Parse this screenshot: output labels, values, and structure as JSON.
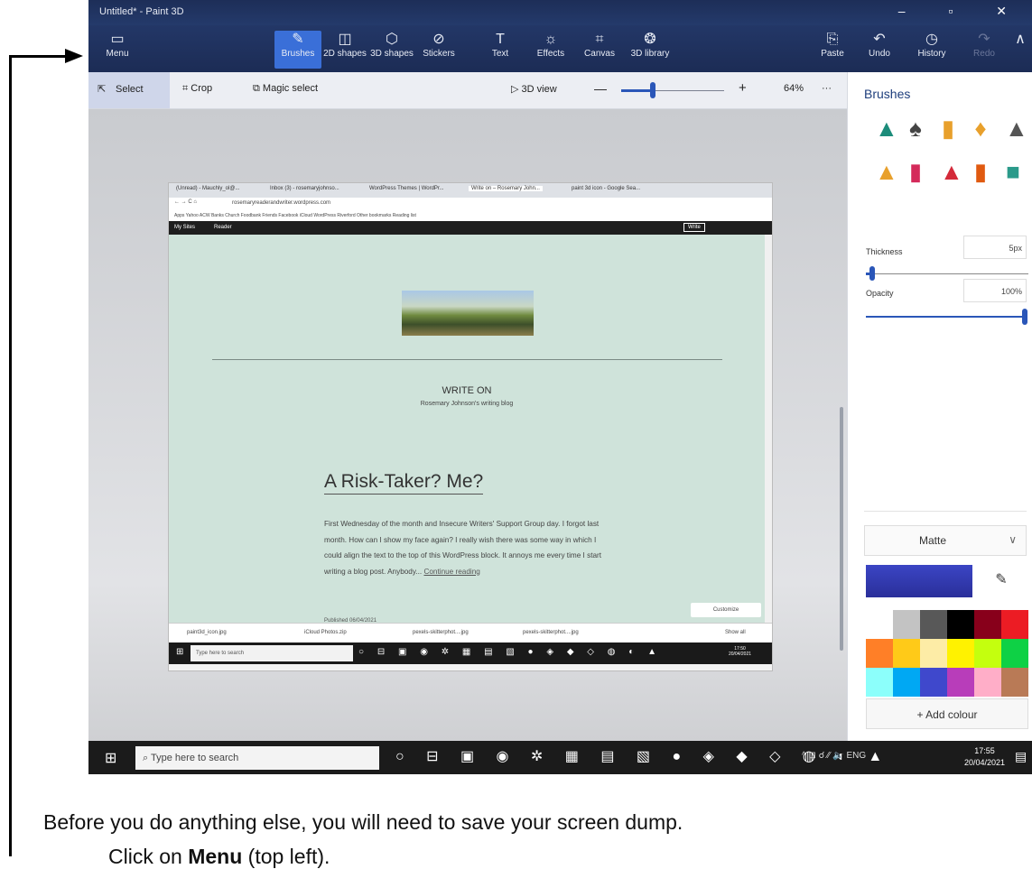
{
  "instruction": {
    "line1": "Before you do anything else, you will need to save your screen dump.",
    "line2_prefix": "Click on ",
    "line2_bold": "Menu",
    "line2_suffix": " (top left)."
  },
  "app": {
    "title": "Untitled* - Paint 3D",
    "window_controls": "–  ▫  ✕"
  },
  "toolbar": {
    "menu": "Menu",
    "brushes": "Brushes",
    "shapes2d": "2D shapes",
    "shapes3d": "3D shapes",
    "stickers": "Stickers",
    "text": "Text",
    "effects": "Effects",
    "canvas": "Canvas",
    "library": "3D library",
    "paste": "Paste",
    "undo": "Undo",
    "history": "History",
    "redo": "Redo"
  },
  "subbar": {
    "select": "Select",
    "crop": "Crop",
    "magic_select": "Magic select",
    "view3d": "3D view",
    "zoom_value": "64%",
    "zoom_fraction": 0.31,
    "more": "···"
  },
  "inner": {
    "tabs": [
      "(Unread) - Mauchly_ol@...",
      "Inbox (3) - rosemaryjohnso...",
      "WordPress Themes | WordPr...",
      "Write on – Rosemary John...",
      "paint 3d icon - Google Sea..."
    ],
    "address": "rosemaryreaderandwriter.wordpress.com",
    "bookmarks": "Apps  Yahoo  ACW  Banks  Church  Foodbank  Friends  Facebook  iCloud  WordPress  Riverford   Other bookmarks  Reading list",
    "wp_my_sites": "My Sites",
    "wp_reader": "Reader",
    "wp_write": "Write",
    "blog_title": "WRITE ON",
    "blog_tagline": "Rosemary Johnson's writing blog",
    "post_title": "A Risk-Taker? Me?",
    "post_body": "First Wednesday of the month and Insecure Writers' Support Group day. I forgot last month. How can I show my face again? I really wish there was some way in which I could align the text to the top of this WordPress block. It annoys me every time I start writing a blog post. Anybody... ",
    "post_link": "Continue reading",
    "customize": "Customize",
    "published": "Published 06/04/2021",
    "downloads": [
      "paint3d_icon.jpg",
      "iCloud Photos.zip",
      "pexels-skitterphot....jpg",
      "pexels-skitterphot....jpg"
    ],
    "show_all": "Show all",
    "search": "Type here to search",
    "clock_time": "17:50",
    "clock_date": "20/04/2021"
  },
  "panel": {
    "title": "Brushes",
    "thickness_label": "Thickness",
    "thickness_value": "5px",
    "opacity_label": "Opacity",
    "opacity_value": "100%",
    "finish": "Matte",
    "add_colour": "Add colour",
    "current_colour": "#3b45c4",
    "palette": [
      "#ffffff",
      "#c3c3c3",
      "#585858",
      "#000000",
      "#88001b",
      "#ec1c24",
      "#ff7f27",
      "#ffca18",
      "#fdeca6",
      "#fff200",
      "#c4ff0e",
      "#0ed145",
      "#8cfffb",
      "#00a8f3",
      "#3f48cc",
      "#b83dba",
      "#ffaec8",
      "#b97a56"
    ]
  },
  "taskbar": {
    "search": "Type here to search",
    "tray": "^  ⊡  ☌  ⁄⁄  🔈  ENG",
    "time": "17:55",
    "date": "20/04/2021"
  }
}
